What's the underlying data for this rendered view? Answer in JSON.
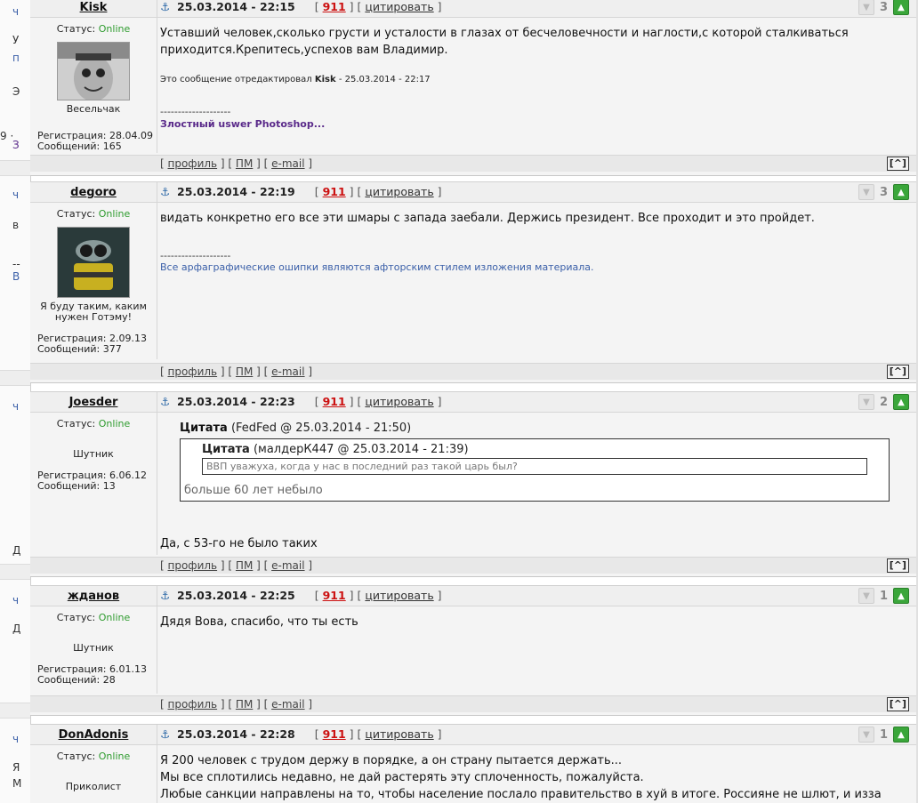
{
  "background_window": {
    "fragments": [
      "ч",
      "У",
      "п",
      "Э",
      "9 ·",
      "З",
      "ч",
      "в",
      "--",
      "В",
      "ч",
      "Д",
      "ч",
      "Д",
      "ч",
      "Я",
      "М"
    ]
  },
  "post_links": {
    "num": "911",
    "quote": "цитировать",
    "profile": "профиль",
    "pm": "ПМ",
    "email": "e-mail",
    "top": "[^]",
    "status_label": "Статус:",
    "status_value": "Online",
    "reg_label": "Регистрация:",
    "msgs_label": "Сообщений:"
  },
  "posts": [
    {
      "author": "Kisk",
      "date": "25.03.2014 - 22:15",
      "rating": "3",
      "rank": "Весельчак",
      "registered": "28.04.09",
      "messages": "165",
      "text1": "Уставший человек,сколько грусти и усталости в глазах от бесчеловечности и наглости,с которой сталкиваться",
      "text2": "приходится.Крепитесь,успехов вам Владимир.",
      "edit_prefix": "Это сообщение отредактировал",
      "edit_author": "Kisk",
      "edit_date": "- 25.03.2014 - 22:17",
      "sig_sep": "--------------------",
      "signature": "Злостный uswer Photoshop..."
    },
    {
      "author": "degoro",
      "date": "25.03.2014 - 22:19",
      "rating": "3",
      "rank1": "Я буду таким, каким",
      "rank2": "нужен Готэму!",
      "registered": "2.09.13",
      "messages": "377",
      "text1": "видать конкретно его все эти шмары с запада заебали. Держись президент. Все проходит и это пройдет.",
      "sig_sep": "--------------------",
      "signature": "Все арфаграфические ошипки являются афторским стилем изложения материала."
    },
    {
      "author": "Joesder",
      "date": "25.03.2014 - 22:23",
      "rating": "2",
      "rank": "Шутник",
      "registered": "6.06.12",
      "messages": "13",
      "quote_label": "Цитата",
      "quote_outer_meta": "(FedFed @ 25.03.2014 - 21:50)",
      "quote_inner_meta": "(малдерК447 @ 25.03.2014 - 21:39)",
      "quote_inner_text": "ВВП уважуха, когда у нас в последний раз такой царь был?",
      "quote_outer_text": "больше 60 лет небыло",
      "text1": "Да, с 53-го не было таких"
    },
    {
      "author": "жданов",
      "date": "25.03.2014 - 22:25",
      "rating": "1",
      "rank": "Шутник",
      "registered": "6.01.13",
      "messages": "28",
      "text1": "Дядя Вова, спасибо, что ты есть"
    },
    {
      "author": "DonAdonis",
      "date": "25.03.2014 - 22:28",
      "rating": "1",
      "rank": "Приколист",
      "text1": "Я 200 человек с трудом держу в порядке, а он страну пытается держать...",
      "text2": "Мы все сплотились недавно, не дай растерять эту сплоченность, пожалуйста.",
      "text3": "Любые санкции направлены на то, чтобы население послало правительство в хуй в итоге. Россияне не шлют, и изза"
    }
  ]
}
